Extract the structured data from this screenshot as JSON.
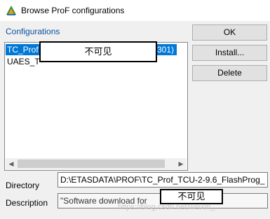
{
  "window": {
    "title": "Browse ProF configurations",
    "icon": "prof-app-icon"
  },
  "configurations": {
    "label": "Configurations",
    "items": [
      {
        "prefix": "TC_Prof",
        "suffix": "(0301)",
        "selected": true
      },
      {
        "prefix": "UAES_T",
        "suffix": "",
        "selected": false
      }
    ],
    "scrollbar": {
      "left_arrow": "◀",
      "right_arrow": "▶"
    }
  },
  "masks": {
    "text": "不可见"
  },
  "buttons": {
    "ok": "OK",
    "install": "Install...",
    "delete": "Delete"
  },
  "directory": {
    "label": "Directory",
    "value": "D:\\ETASDATA\\PROF\\TC_Prof_TCU-2-9.6_FlashProg_"
  },
  "description": {
    "label": "Description",
    "value": "\"Software download for"
  },
  "watermark": {
    "text": "https://blog.csdn.net/weixin_"
  },
  "colors": {
    "selection": "#0078d7",
    "group_label": "#0a4f9e"
  }
}
